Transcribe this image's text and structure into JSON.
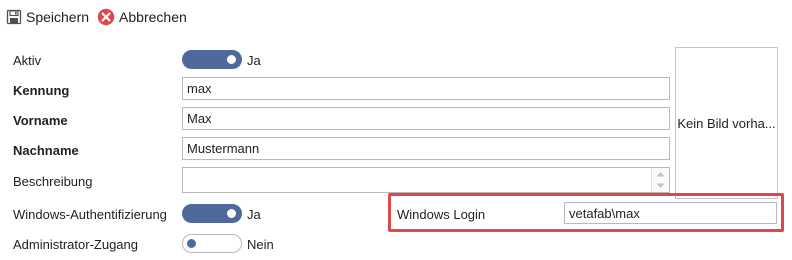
{
  "toolbar": {
    "save": {
      "label": "Speichern",
      "icon": "floppy-disk-icon"
    },
    "cancel": {
      "label": "Abbrechen",
      "icon": "cancel-x-icon",
      "color": "#e0474c"
    }
  },
  "form": {
    "aktiv": {
      "label": "Aktiv",
      "on": true,
      "state_text": "Ja"
    },
    "kennung": {
      "label": "Kennung",
      "value": "max"
    },
    "vorname": {
      "label": "Vorname",
      "value": "Max"
    },
    "nachname": {
      "label": "Nachname",
      "value": "Mustermann"
    },
    "beschreibung": {
      "label": "Beschreibung",
      "value": ""
    },
    "windows_auth": {
      "label": "Windows-Authentifizierung",
      "on": true,
      "state_text": "Ja"
    },
    "admin": {
      "label": "Administrator-Zugang",
      "on": false,
      "state_text": "Nein"
    }
  },
  "image_box": {
    "text": "Kein Bild vorha..."
  },
  "windows_login": {
    "label": "Windows Login",
    "value": "vetafab\\max",
    "highlight_color": "#e0474c"
  },
  "colors": {
    "toggle_accent": "#4f6a9a"
  }
}
